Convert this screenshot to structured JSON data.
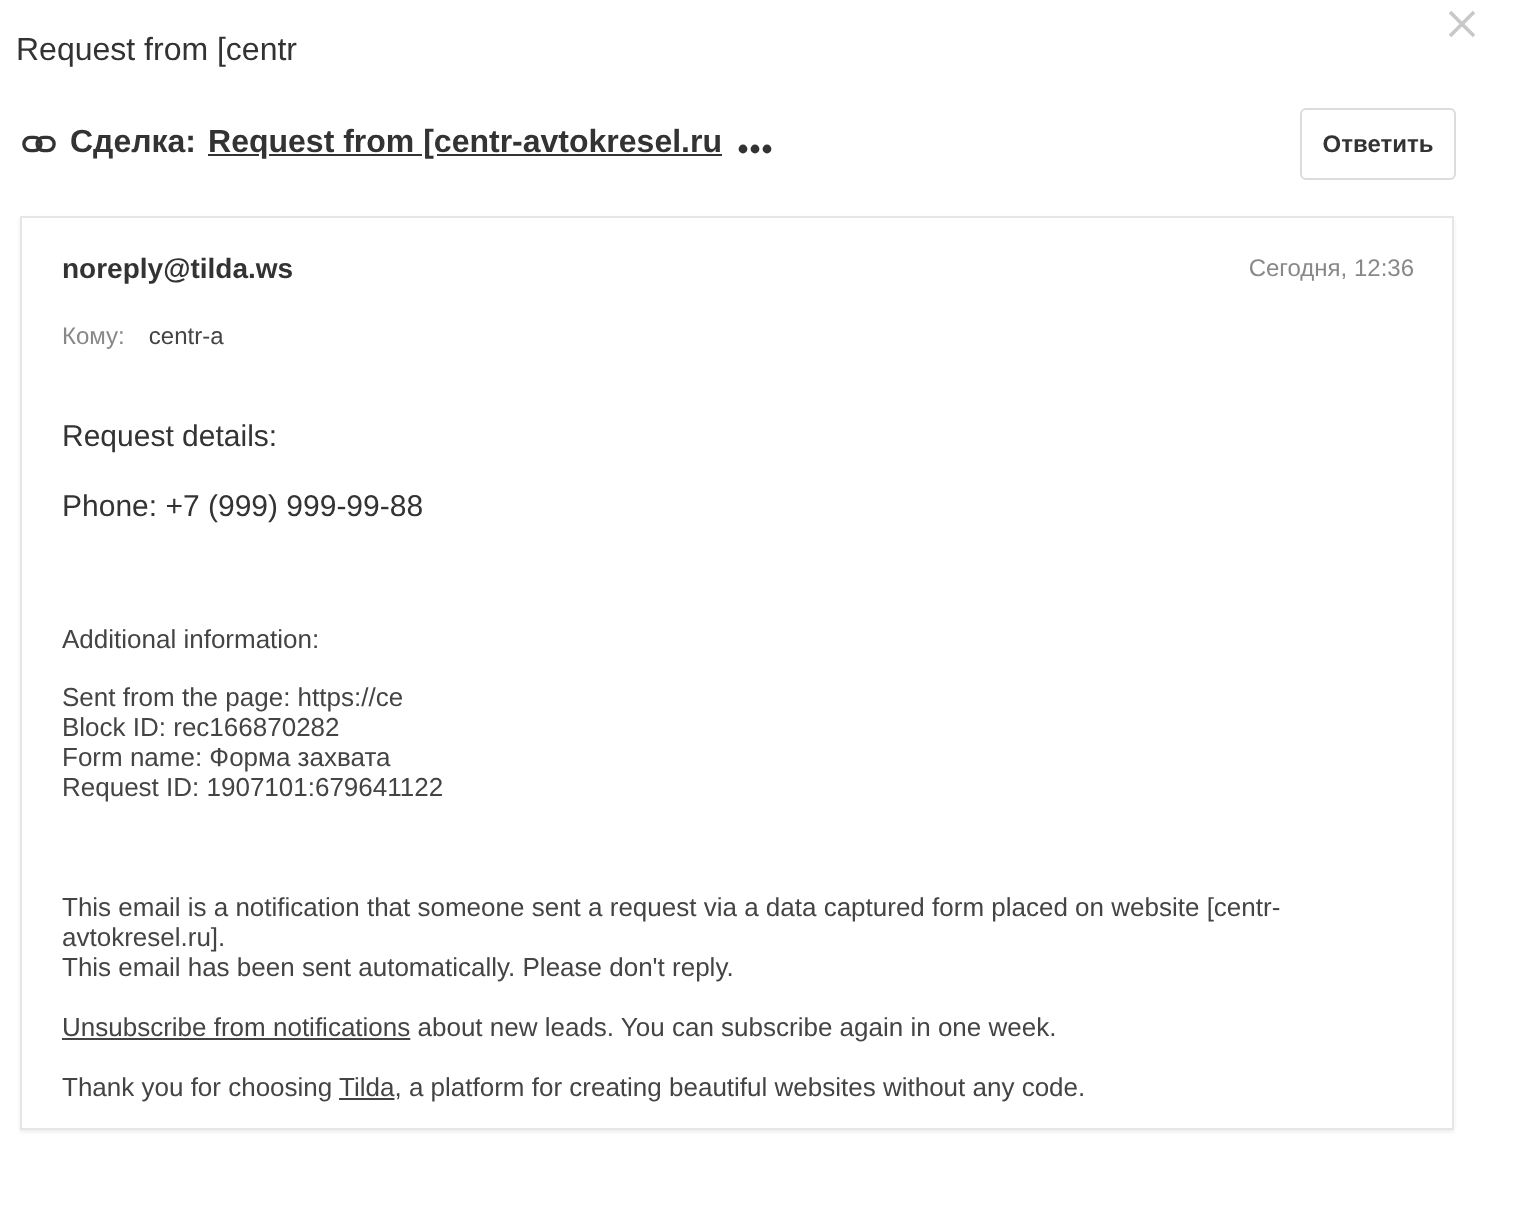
{
  "dialog": {
    "title": "Request from [centr"
  },
  "deal": {
    "label": "Сделка:",
    "link": "Request from [centr-avtokresel.ru"
  },
  "reply_button": "Ответить",
  "message": {
    "from": "noreply@tilda.ws",
    "date": "Сегодня, 12:36",
    "to_label": "Кому:",
    "to": "centr-a",
    "request": {
      "title": "Request details:",
      "fields": [
        "Phone: +7 (999) 999-99-88"
      ]
    },
    "additional": {
      "title": "Additional information:",
      "lines": [
        "Sent from the page: https://ce",
        "Block ID: rec166870282",
        "Form name: Форма захвата",
        "Request ID: 1907101:679641122"
      ]
    },
    "notes": [
      {
        "kind": "lines",
        "lines": [
          "This email is a notification that someone sent a request via a data captured form placed on website [centr-avtokresel.ru].",
          "This email has been sent automatically. Please don't reply."
        ]
      },
      {
        "kind": "parts",
        "parts": [
          {
            "kind": "link",
            "text": "Unsubscribe from notifications"
          },
          {
            "kind": "text",
            "text": " about new leads. You can subscribe again in one week."
          }
        ]
      },
      {
        "kind": "parts",
        "parts": [
          {
            "kind": "text",
            "text": "Thank you for choosing "
          },
          {
            "kind": "link",
            "text": "Tilda"
          },
          {
            "kind": "text",
            "text": ", a platform for creating beautiful websites without any code."
          }
        ]
      }
    ]
  }
}
